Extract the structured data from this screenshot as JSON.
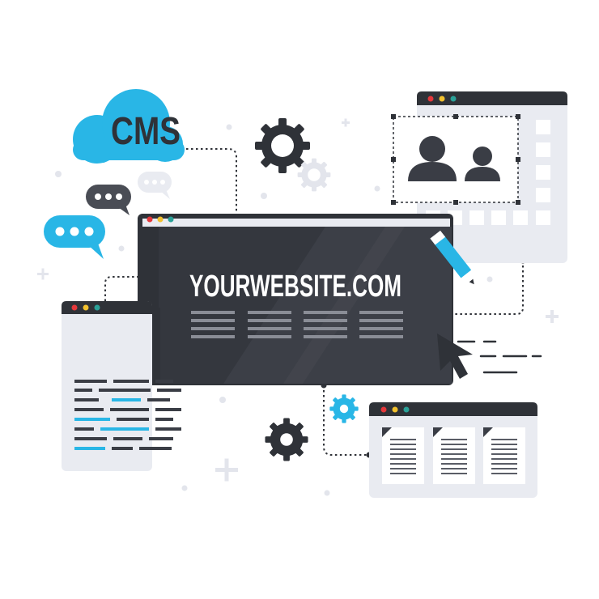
{
  "cloud": {
    "label": "CMS"
  },
  "main_window": {
    "title": "YOURWEBSITE.COM"
  },
  "colors": {
    "accent": "#29b6e6",
    "dark": "#34373f",
    "panel": "#e9ebf1",
    "panel_dark": "#3a3d45",
    "dot_red": "#e5383b",
    "dot_yellow": "#f2c12e",
    "dot_teal": "#2aa198"
  },
  "icons": [
    "cloud-icon",
    "gear-icon",
    "chat-bubble-icon",
    "user-group-icon",
    "pencil-icon",
    "cursor-icon",
    "document-icon",
    "plus-icon"
  ]
}
